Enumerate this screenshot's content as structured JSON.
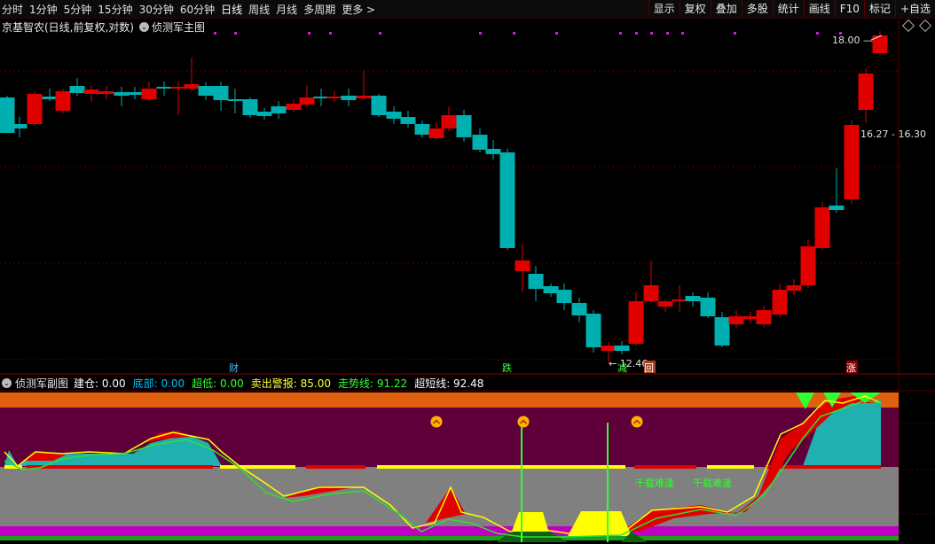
{
  "toolbar": {
    "periods": [
      "分时",
      "1分钟",
      "5分钟",
      "15分钟",
      "30分钟",
      "60分钟",
      "日线",
      "周线",
      "月线",
      "多周期",
      "更多 >"
    ],
    "active_period": "日线",
    "actions": [
      "显示",
      "复权",
      "叠加",
      "多股",
      "统计",
      "画线",
      "F10",
      "标记",
      "+自选"
    ]
  },
  "main_header": {
    "stock": "京基智农(日线,前复权,对数)",
    "indicator": "侦测军主图"
  },
  "sub_header": {
    "name": "侦测军副图",
    "items": [
      {
        "label": "建仓: 0.00",
        "color": "#ffffff"
      },
      {
        "label": "底部: 0.00",
        "color": "#00bfff"
      },
      {
        "label": "超低: 0.00",
        "color": "#33ff33"
      },
      {
        "label": "卖出警报: 85.00",
        "color": "#ffff33"
      },
      {
        "label": "走势线: 91.22",
        "color": "#33ff33"
      },
      {
        "label": "超短线: 92.48",
        "color": "#ffffff"
      }
    ]
  },
  "price_labels": {
    "high": "18.00",
    "range": "16.27 - 16.30",
    "low": "12.46"
  },
  "signals": {
    "cai": "财",
    "die": "跌",
    "jian": "减",
    "hui": "回",
    "zhang": "涨"
  },
  "sub_chart_text": {
    "rare1": "千载难逢",
    "rare2": "千载难逢"
  },
  "colors": {
    "up": "#e00000",
    "down": "#00b0b0",
    "grid": "#5a0000",
    "sub_top_band": "#e06010",
    "sub_upper_zone": "#60003a",
    "sub_lower_zone": "#808080"
  }
}
